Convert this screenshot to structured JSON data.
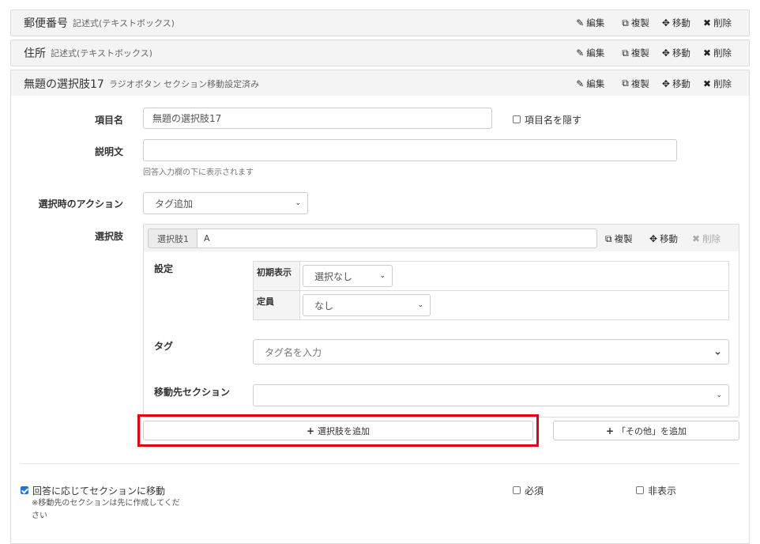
{
  "fields": [
    {
      "title": "郵便番号",
      "type": "記述式(テキストボックス)"
    },
    {
      "title": "住所",
      "type": "記述式(テキストボックス)"
    },
    {
      "title": "無題の選択肢17",
      "type": "ラジオボタン セクション移動設定済み"
    }
  ],
  "actions": {
    "edit": "編集",
    "copy": "複製",
    "move": "移動",
    "delete": "削除"
  },
  "form": {
    "item_name_label": "項目名",
    "item_name_value": "無題の選択肢17",
    "hide_name_label": "項目名を隠す",
    "desc_label": "説明文",
    "desc_value": "",
    "desc_help": "回答入力欄の下に表示されます",
    "action_label": "選択時のアクション",
    "action_value": "タグ追加",
    "choices_label": "選択肢"
  },
  "choice": {
    "prefix": "選択肢1",
    "value": "A",
    "settings_label": "設定",
    "initial_label": "初期表示",
    "initial_value": "選択なし",
    "capacity_label": "定員",
    "capacity_value": "なし",
    "tag_label": "タグ",
    "tag_placeholder": "タグ名を入力",
    "section_label": "移動先セクション",
    "section_value": ""
  },
  "buttons": {
    "add_choice": "選択肢を追加",
    "add_other": "「その他」を追加"
  },
  "footer": {
    "move_section_label": "回答に応じてセクションに移動",
    "move_section_checked": true,
    "move_section_note_line1": "※移動先のセクションは先に作成してくだ",
    "move_section_note_line2": "さい",
    "required_label": "必須",
    "hidden_label": "非表示"
  },
  "colors": {
    "highlight": "#e60012",
    "checkbox_on": "#1a73e8"
  }
}
